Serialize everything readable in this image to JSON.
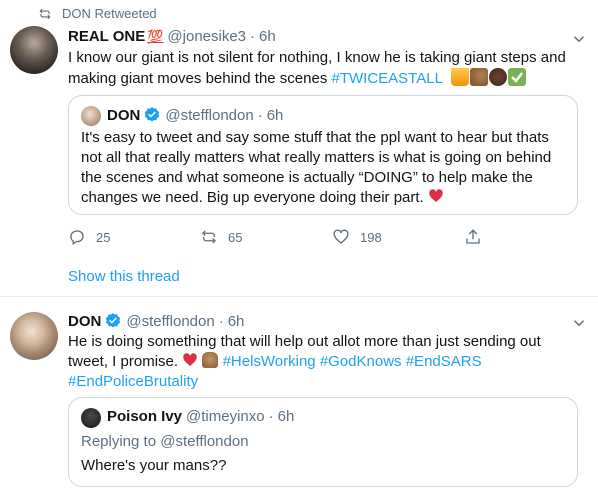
{
  "tweet1": {
    "retweeted_by": "DON Retweeted",
    "author_name": "REAL ONE",
    "author_emoji": "💯",
    "handle": "@jonesike3",
    "dot": "·",
    "time": "6h",
    "text_line1": "I know our giant is not silent for nothing, I know he is taking giant steps and",
    "text_line2_prefix": "making giant moves behind the scenes ",
    "hashtag": "#TWICEASTALL",
    "quote": {
      "author_name": "DON",
      "handle": "@stefflondon",
      "dot": "·",
      "time": "6h",
      "line1": "It's easy to tweet and say some stuff that the ppl want to hear but thats",
      "line2": "not all that really matters what really matters is what is going on behind",
      "line3": "the scenes and what someone is actually “DOING” to help make the",
      "line4": "changes we need. Big up everyone doing their part."
    },
    "actions": {
      "replies": "25",
      "retweets": "65",
      "likes": "198"
    },
    "show_thread": "Show this thread"
  },
  "tweet2": {
    "author_name": "DON",
    "handle": "@stefflondon",
    "dot": "·",
    "time": "6h",
    "line1": "He is doing something that will help out allot more than just sending out",
    "line2_prefix": "tweet, I promise. ",
    "hashtags_line2": [
      "#HelsWorking",
      "#GodKnows",
      "#EndSARS"
    ],
    "hashtag_line3": "#EndPoliceBrutality",
    "quote": {
      "author_name": "Poison Ivy",
      "handle": "@timeyinxo",
      "dot": "·",
      "time": "6h",
      "replying_to": "Replying to @stefflondon",
      "text": "Where's your mans??"
    }
  },
  "colors": {
    "accent": "#1da1f2",
    "secondary_text": "#5b7083",
    "border": "#ccd6dd",
    "heart": "#e0245e"
  }
}
